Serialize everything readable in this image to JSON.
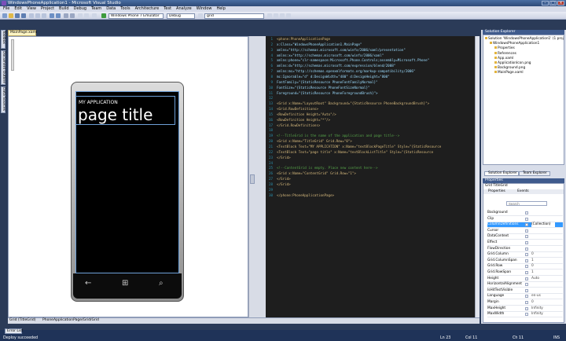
{
  "window": {
    "title": "WindowsPhoneApplication1 - Microsoft Visual Studio"
  },
  "menu": [
    "File",
    "Edit",
    "View",
    "Project",
    "Build",
    "Debug",
    "Team",
    "Data",
    "Tools",
    "Architecture",
    "Test",
    "Analyze",
    "Window",
    "Help"
  ],
  "toolbar": {
    "target_device": "Windows Phone 7 Emulator",
    "configuration": "Debug",
    "find": "grid"
  },
  "left_tabs": [
    "Toolbox",
    "Document Outline",
    "Data Sources"
  ],
  "designer": {
    "tab": "MainPage.xaml",
    "application_name": "MY APPLICATION",
    "page_title": "page title",
    "nav_back": "←",
    "nav_start": "⊞",
    "nav_search": "⌕"
  },
  "code_lines": [
    "<phone:PhoneApplicationPage",
    "    x:Class=\"WindowsPhoneApplication1.MainPage\"",
    "    xmlns=\"http://schemas.microsoft.com/winfx/2006/xaml/presentation\"",
    "    xmlns:x=\"http://schemas.microsoft.com/winfx/2006/xaml\"",
    "    xmlns:phone=\"clr-namespace:Microsoft.Phone.Controls;assembly=Microsoft.Phone\"",
    "    xmlns:d=\"http://schemas.microsoft.com/expression/blend/2008\"",
    "    xmlns:mc=\"http://schemas.openxmlformats.org/markup-compatibility/2006\"",
    "    mc:Ignorable=\"d\" d:DesignWidth=\"480\" d:DesignHeight=\"800\"",
    "    FontFamily=\"{StaticResource PhoneFontFamilyNormal}\"",
    "    FontSize=\"{StaticResource PhoneFontSizeNormal}\"",
    "    Foreground=\"{StaticResource PhoneForegroundBrush}\">",
    "",
    "    <Grid x:Name=\"LayoutRoot\" Background=\"{StaticResource PhoneBackgroundBrush}\">",
    "        <Grid.RowDefinitions>",
    "            <RowDefinition Height=\"Auto\"/>",
    "            <RowDefinition Height=\"*\"/>",
    "        </Grid.RowDefinitions>",
    "",
    "        <!--TitleGrid is the name of the application and page title-->",
    "        <Grid x:Name=\"TitleGrid\" Grid.Row=\"0\">",
    "            <TextBlock Text=\"MY APPLICATION\" x:Name=\"textBlockPageTitle\" Style=\"{StaticResource",
    "            <TextBlock Text=\"page title\" x:Name=\"textBlockListTitle\" Style=\"{StaticResource",
    "        </Grid>",
    "",
    "        <!--ContentGrid is empty. Place new content here-->",
    "        <Grid x:Name=\"ContentGrid\" Grid.Row=\"1\">",
    "        </Grid>",
    "    </Grid>",
    "",
    "</phone:PhoneApplicationPage>"
  ],
  "designer_strip": {
    "breadcrumb": "Grid (TitleGrid)",
    "path": "PhoneApplicationPage/Grid/Grid"
  },
  "solution_explorer": {
    "title": "Solution Explorer",
    "items": [
      {
        "label": "Solution 'WindowsPhoneApplication1' (1 proj",
        "indent": 0
      },
      {
        "label": "WindowsPhoneApplication1",
        "indent": 1
      },
      {
        "label": "Properties",
        "indent": 2
      },
      {
        "label": "References",
        "indent": 2
      },
      {
        "label": "App.xaml",
        "indent": 2
      },
      {
        "label": "ApplicationIcon.png",
        "indent": 2
      },
      {
        "label": "Background.png",
        "indent": 2
      },
      {
        "label": "MainPage.xaml",
        "indent": 2
      }
    ],
    "tabs": [
      "Solution Explorer",
      "Team Explorer"
    ]
  },
  "properties": {
    "title": "Properties",
    "object": "Grid  TitleGrid",
    "tabs": [
      "Properties",
      "Events"
    ],
    "search_placeholder": "Search",
    "rows": [
      {
        "name": "Background",
        "value": ""
      },
      {
        "name": "Clip",
        "value": ""
      },
      {
        "name": "ColumnDefinitions",
        "value": "(Collection)",
        "selected": true
      },
      {
        "name": "Cursor",
        "value": ""
      },
      {
        "name": "DataContext",
        "value": ""
      },
      {
        "name": "Effect",
        "value": ""
      },
      {
        "name": "FlowDirection",
        "value": ""
      },
      {
        "name": "Grid.Column",
        "value": "0"
      },
      {
        "name": "Grid.ColumnSpan",
        "value": "1"
      },
      {
        "name": "Grid.Row",
        "value": "0"
      },
      {
        "name": "Grid.RowSpan",
        "value": "1"
      },
      {
        "name": "Height",
        "value": "Auto"
      },
      {
        "name": "HorizontalAlignment",
        "value": ""
      },
      {
        "name": "IsHitTestVisible",
        "value": ""
      },
      {
        "name": "Language",
        "value": "en-us"
      },
      {
        "name": "Margin",
        "value": "0"
      },
      {
        "name": "MaxHeight",
        "value": "Infinity"
      },
      {
        "name": "MaxWidth",
        "value": "Infinity"
      }
    ]
  },
  "statusbar": {
    "error_tab": "Error List",
    "status": "Deploy succeeded",
    "ln": "Ln 23",
    "col": "Col 11",
    "ch": "Ch 11",
    "mode": "INS"
  }
}
